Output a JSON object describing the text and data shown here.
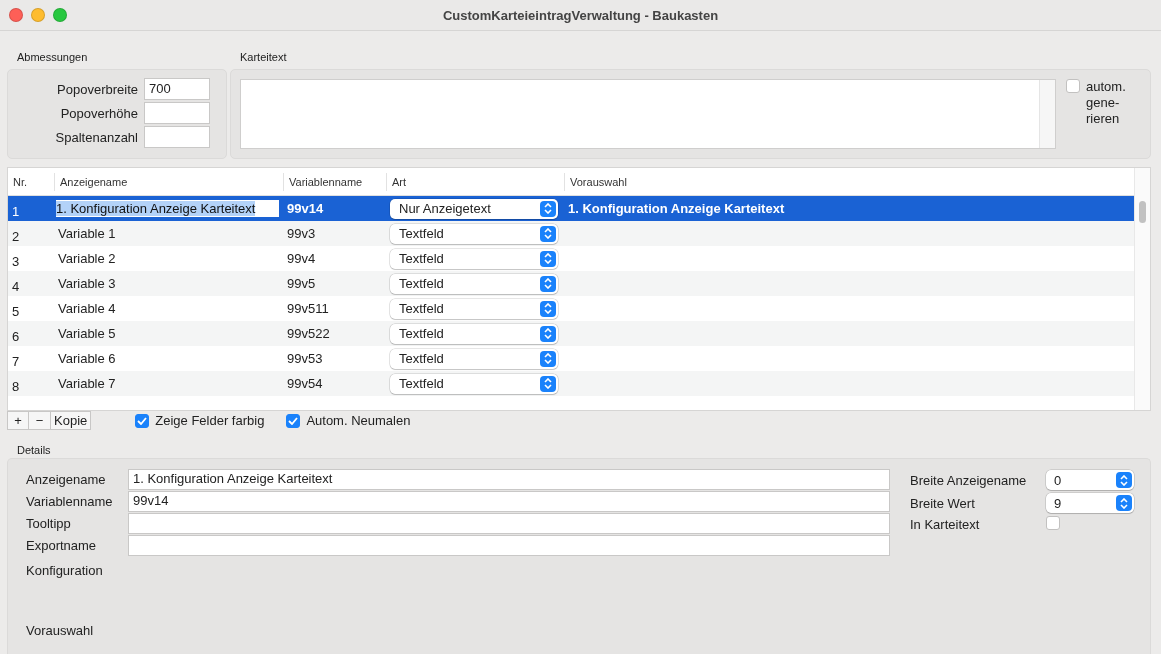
{
  "window": {
    "title": "CustomKarteieintragVerwaltung - Baukasten"
  },
  "dimensions": {
    "label": "Abmessungen",
    "fields": [
      {
        "label": "Popoverbreite",
        "value": "700"
      },
      {
        "label": "Popoverhöhe"
      },
      {
        "label": "Spaltenanzahl"
      }
    ]
  },
  "card_text": {
    "label": "Karteitext",
    "auto_generate": {
      "lines": [
        "autom.",
        "gene-",
        "rieren"
      ],
      "checked": false
    }
  },
  "table": {
    "columns": [
      "Nr.",
      "Anzeigename",
      "Variablenname",
      "Art",
      "Vorauswahl"
    ],
    "rows": [
      {
        "nr": "1",
        "display_name": "1. Konfiguration Anzeige Karteitext",
        "variable": "99v14",
        "type": "Nur Anzeigetext",
        "preselection": "1. Konfiguration Anzeige Karteitext",
        "selected": true
      },
      {
        "nr": "2",
        "display_name": "Variable 1",
        "variable": "99v3",
        "type": "Textfeld",
        "selected": false
      },
      {
        "nr": "3",
        "display_name": "Variable 2",
        "variable": "99v4",
        "type": "Textfeld",
        "selected": false
      },
      {
        "nr": "4",
        "display_name": "Variable 3",
        "variable": "99v5",
        "type": "Textfeld",
        "selected": false
      },
      {
        "nr": "5",
        "display_name": "Variable 4",
        "variable": "99v511",
        "type": "Textfeld",
        "selected": false
      },
      {
        "nr": "6",
        "display_name": "Variable 5",
        "variable": "99v522",
        "type": "Textfeld",
        "selected": false
      },
      {
        "nr": "7",
        "display_name": "Variable 6",
        "variable": "99v53",
        "type": "Textfeld",
        "selected": false
      },
      {
        "nr": "8",
        "display_name": "Variable 7",
        "variable": "99v54",
        "type": "Textfeld",
        "selected": false
      }
    ]
  },
  "table_buttons": [
    "+",
    "−",
    "Kopie"
  ],
  "options": [
    {
      "label": "Zeige Felder farbig",
      "checked": true
    },
    {
      "label": "Autom. Neumalen",
      "checked": true
    }
  ],
  "details": {
    "label": "Details",
    "fields": [
      {
        "label": "Anzeigename",
        "value": "1. Konfiguration Anzeige Karteitext"
      },
      {
        "label": "Variablenname",
        "value": "99v14"
      },
      {
        "label": "Tooltipp"
      },
      {
        "label": "Exportname"
      }
    ],
    "sections": [
      "Konfiguration",
      "Vorauswahl"
    ],
    "steppers": [
      {
        "label": "Breite Anzeigename",
        "value": "0"
      },
      {
        "label": "Breite Wert",
        "value": "9"
      }
    ],
    "in_card_text": {
      "label": "In Karteitext",
      "checked": false
    }
  }
}
